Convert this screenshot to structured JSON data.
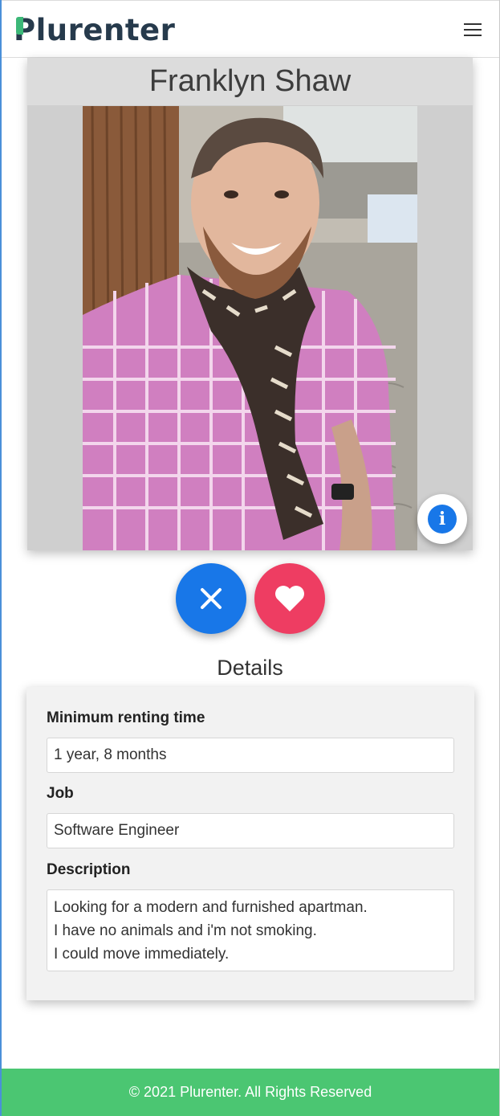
{
  "app": {
    "brand": "Plurenter",
    "brand_first": "P",
    "brand_rest": "lurenter",
    "accent_color": "#3cb878"
  },
  "navbar": {
    "menu_icon": "hamburger-menu-icon"
  },
  "profile": {
    "name": "Franklyn Shaw",
    "photo_count": 2,
    "active_photo": 1,
    "info_icon": "info-icon",
    "info_symbol": "i"
  },
  "actions": {
    "reject_icon": "close-icon",
    "like_icon": "heart-icon",
    "reject_color": "#1877e8",
    "like_color": "#ee3d62"
  },
  "details": {
    "heading": "Details",
    "fields": [
      {
        "label": "Minimum renting time",
        "value": "1 year, 8 months"
      },
      {
        "label": "Job",
        "value": "Software Engineer"
      },
      {
        "label": "Description",
        "lines": [
          "Looking for a modern and furnished apartman.",
          "I have no animals and i'm not smoking.",
          "I could move immediately."
        ]
      }
    ]
  },
  "footer": {
    "text": "© 2021 Plurenter. All Rights Reserved",
    "color": "#4bc672"
  }
}
